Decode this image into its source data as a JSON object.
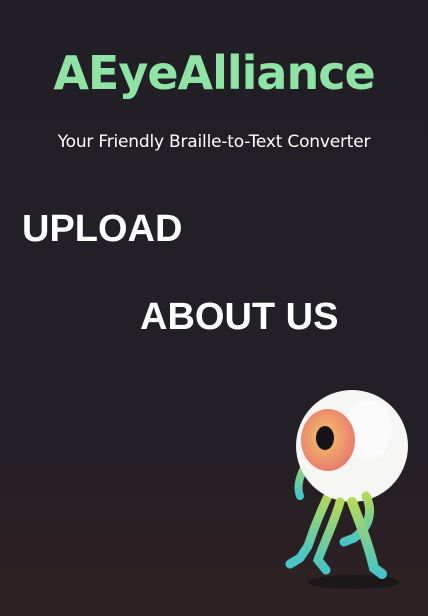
{
  "header": {
    "title": "AEyeAlliance",
    "tagline": "Your Friendly Braille-to-Text Converter"
  },
  "nav": {
    "upload_label": "UPLOAD",
    "about_label": "ABOUT US"
  },
  "mascot": {
    "icon": "walking-eyeball-mascot"
  },
  "colors": {
    "background": "#211f25",
    "title": "#8fe3a5",
    "text": "#ffffff",
    "iris_outer": "#e99070",
    "iris_inner": "#f0b870",
    "legs_gradient_top": "#a8d45a",
    "legs_gradient_bottom": "#49c6c4"
  }
}
